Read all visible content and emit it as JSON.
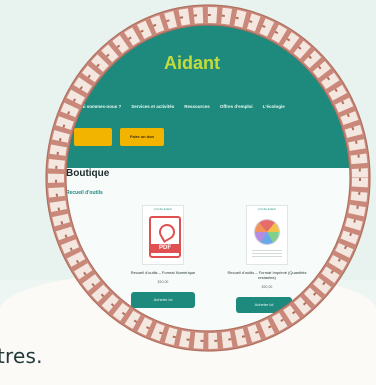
{
  "caption": "tres.",
  "site": {
    "title": "Aidant",
    "nav": [
      "Qui sommes-nous ?",
      "Services et activités",
      "Ressources",
      "Offres d'emploi",
      "L'écologie"
    ],
    "buttons": [
      "",
      "Faire un don"
    ]
  },
  "page": {
    "title": "Boutique",
    "subhead": "Recueil d'outils"
  },
  "products": [
    {
      "brand": "proche aidant",
      "tag": "PDF",
      "title": "Recueil d'outils – Format Numérique",
      "price": "$10,00",
      "button": "Acheter ici"
    },
    {
      "brand": "proche aidant",
      "tag": "",
      "title": "Recueil d'outils – Format Imprimé (Quantités restantes)",
      "price": "$20,00",
      "button": "Acheter ici"
    }
  ],
  "colors": {
    "header": "#1e8a7d",
    "accent": "#c4dc3a",
    "button": "#f3b400",
    "rope": "#c9887a"
  }
}
